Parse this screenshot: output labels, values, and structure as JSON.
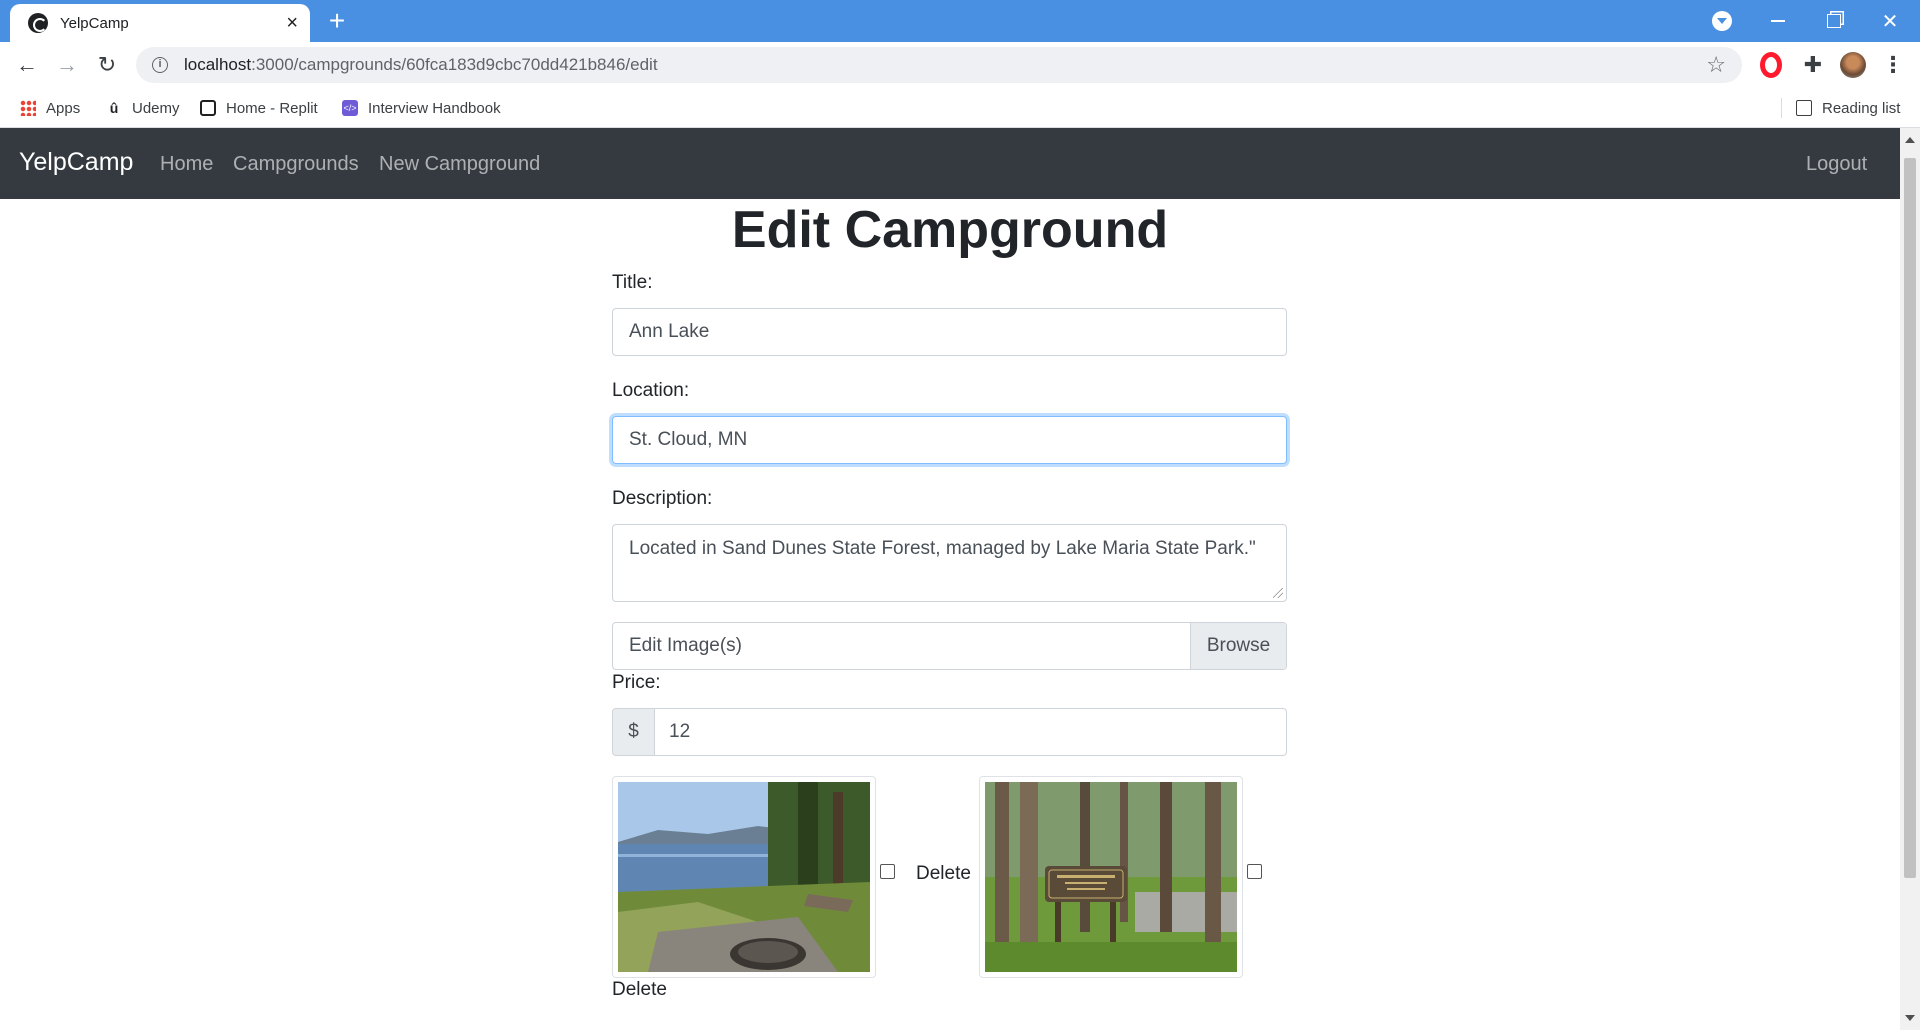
{
  "browser": {
    "tab_title": "YelpCamp",
    "url_host": "localhost",
    "url_path": ":3000/campgrounds/60fca183d9cbc70dd421b846/edit",
    "bookmarks": [
      "Apps",
      "Udemy",
      "Home - Replit",
      "Interview Handbook"
    ],
    "reading_list": "Reading list"
  },
  "navbar": {
    "brand": "YelpCamp",
    "links": [
      "Home",
      "Campgrounds",
      "New Campground"
    ],
    "logout": "Logout"
  },
  "form": {
    "heading": "Edit Campground",
    "title_label": "Title:",
    "title_value": "Ann Lake",
    "location_label": "Location:",
    "location_value": "St. Cloud, MN",
    "description_label": "Description:",
    "description_value": "Located in Sand Dunes State Forest, managed by Lake Maria State Park.\"",
    "image_label": "Edit Image(s)",
    "browse_label": "Browse",
    "price_label": "Price:",
    "price_currency": "$",
    "price_value": "12",
    "images": [
      {
        "alt": "lake view with fire ring",
        "delete_label": "Delete"
      },
      {
        "alt": "Sand Dunes State Forest sign",
        "delete_label": "Delete"
      }
    ]
  },
  "colors": {
    "chrome_tabbar": "#4a90e2",
    "navbar_bg": "#343a40",
    "focus_border": "#80bdff"
  }
}
